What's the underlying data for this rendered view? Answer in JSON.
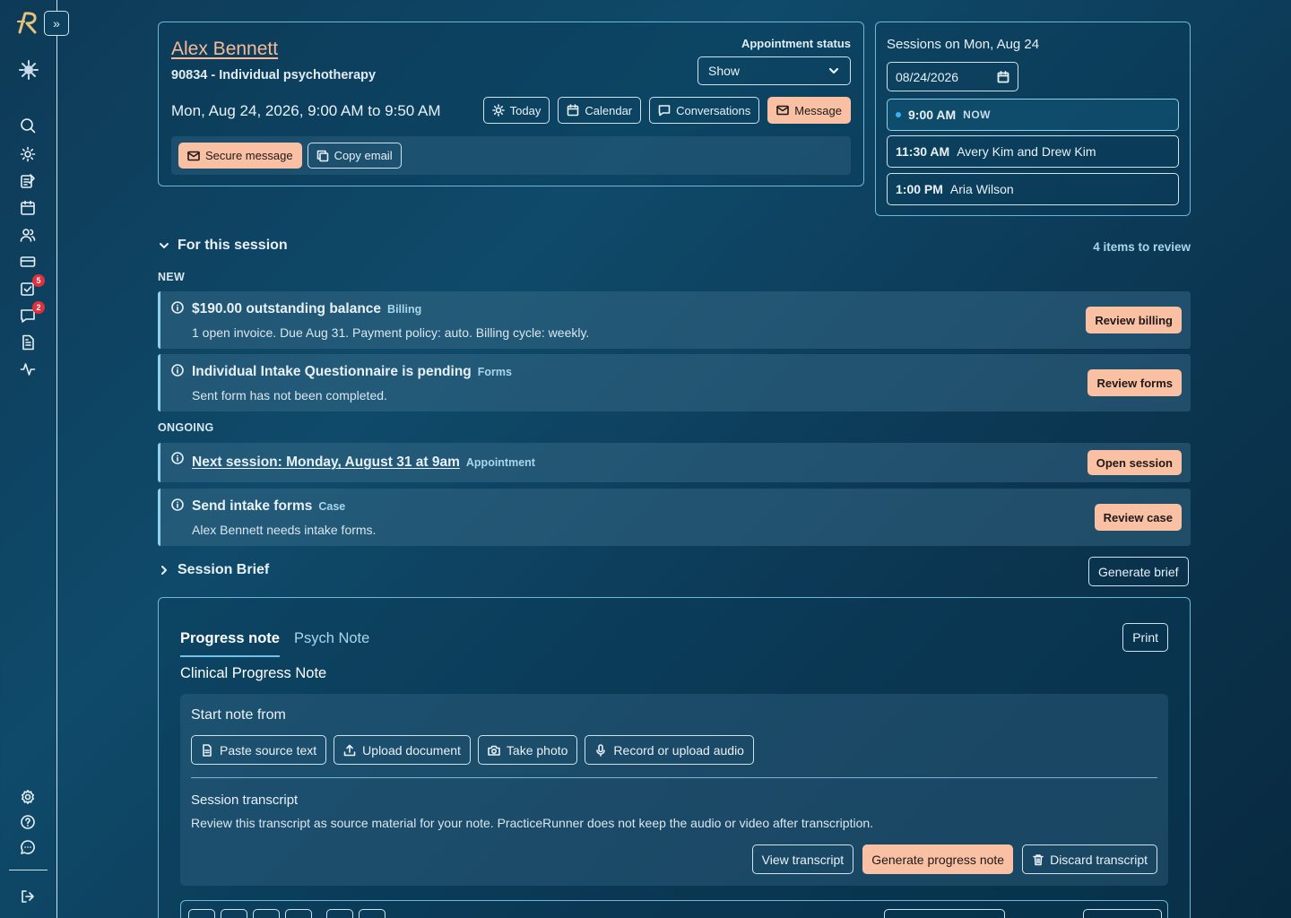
{
  "sidebar": {
    "expand_label": "»",
    "tasks_badge": "5",
    "messages_badge": "2"
  },
  "appointment": {
    "client_name": "Alex Bennett",
    "service": "90834 - Individual psychotherapy",
    "datetime": "Mon, Aug 24, 2026, 9:00 AM to 9:50 AM",
    "status_label": "Appointment status",
    "status_value": "Show",
    "actions": {
      "today": "Today",
      "calendar": "Calendar",
      "conversations": "Conversations",
      "message": "Message"
    },
    "secure_message": "Secure message",
    "copy_email": "Copy email"
  },
  "sessions": {
    "title": "Sessions on Mon, Aug 24",
    "date_value": "08/24/2026",
    "items": [
      {
        "time": "9:00 AM",
        "label": "NOW"
      },
      {
        "time": "11:30 AM",
        "label": "Avery Kim and Drew Kim"
      },
      {
        "time": "1:00 PM",
        "label": "Aria Wilson"
      }
    ]
  },
  "review": {
    "section_title": "For this session",
    "count": "4 items to review",
    "new_label": "NEW",
    "ongoing_label": "ONGOING",
    "items": [
      {
        "title": "$190.00 outstanding balance",
        "tag": "Billing",
        "desc": "1 open invoice. Due Aug 31. Payment policy: auto. Billing cycle: weekly.",
        "action": "Review billing"
      },
      {
        "title": "Individual Intake Questionnaire is pending",
        "tag": "Forms",
        "desc": "Sent form has not been completed.",
        "action": "Review forms"
      },
      {
        "title": "Next session: Monday, August 31 at 9am",
        "tag": "Appointment",
        "desc": "",
        "action": "Open session"
      },
      {
        "title": "Send intake forms",
        "tag": "Case",
        "desc": "Alex Bennett needs intake forms.",
        "action": "Review case"
      }
    ]
  },
  "brief": {
    "title": "Session Brief",
    "generate": "Generate brief"
  },
  "note": {
    "tabs": [
      "Progress note",
      "Psych Note"
    ],
    "print": "Print",
    "heading": "Clinical Progress Note",
    "start_title": "Start note from",
    "sources": [
      "Paste source text",
      "Upload document",
      "Take photo",
      "Record or upload audio"
    ],
    "transcript_title": "Session transcript",
    "transcript_desc": "Review this transcript as source material for your note. PracticeRunner does not keep the audio or video after transcription.",
    "view_transcript": "View transcript",
    "generate_note": "Generate progress note",
    "discard_transcript": "Discard transcript"
  }
}
